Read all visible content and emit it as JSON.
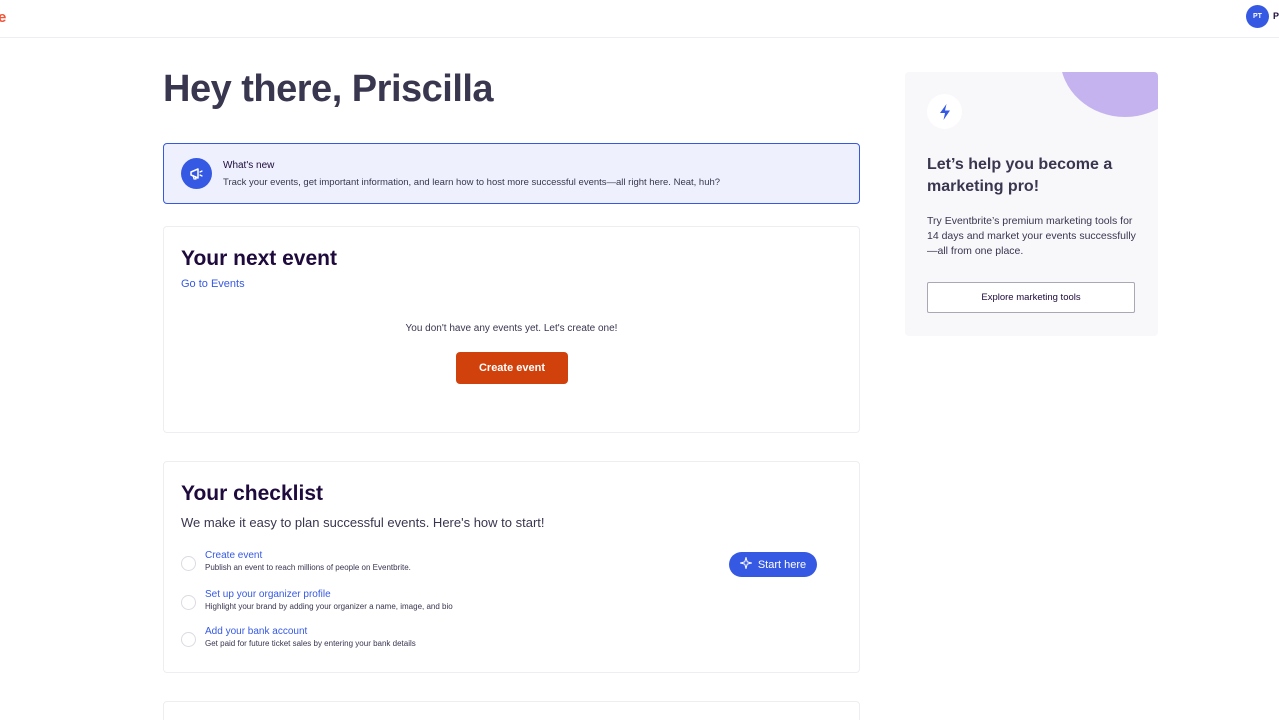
{
  "header": {
    "logo_text": "e",
    "avatar_initials": "PT",
    "avatar_name_fragment": "P"
  },
  "greeting": "Hey there, Priscilla",
  "whats_new": {
    "icon": "megaphone-icon",
    "title": "What's new",
    "text": "Track your events, get important information, and learn how to host more successful events—all right here. Neat, huh?"
  },
  "next_event": {
    "title": "Your next event",
    "link": "Go to Events",
    "empty_message": "You don't have any events yet. Let's create one!",
    "create_button": "Create event"
  },
  "checklist": {
    "title": "Your checklist",
    "subtitle": "We make it easy to plan successful events. Here's how to start!",
    "items": [
      {
        "label": "Create event",
        "description": "Publish an event to reach millions of people on Eventbrite."
      },
      {
        "label": "Set up your organizer profile",
        "description": "Highlight your brand by adding your organizer a name, image, and bio"
      },
      {
        "label": "Add your bank account",
        "description": "Get paid for future ticket sales by entering your bank details"
      }
    ],
    "start_button": "Start here",
    "start_icon": "sparkle-icon"
  },
  "promo": {
    "icon": "lightning-icon",
    "title": "Let’s help you become a marketing pro!",
    "text": "Try Eventbrite’s premium marketing tools for 14 days and market your events successfully—all from one place.",
    "button": "Explore marketing tools"
  },
  "colors": {
    "brand_orange": "#d1410c",
    "logo_orange": "#f05537",
    "link_blue": "#3659e3",
    "promo_purple": "#c5b3f0"
  }
}
